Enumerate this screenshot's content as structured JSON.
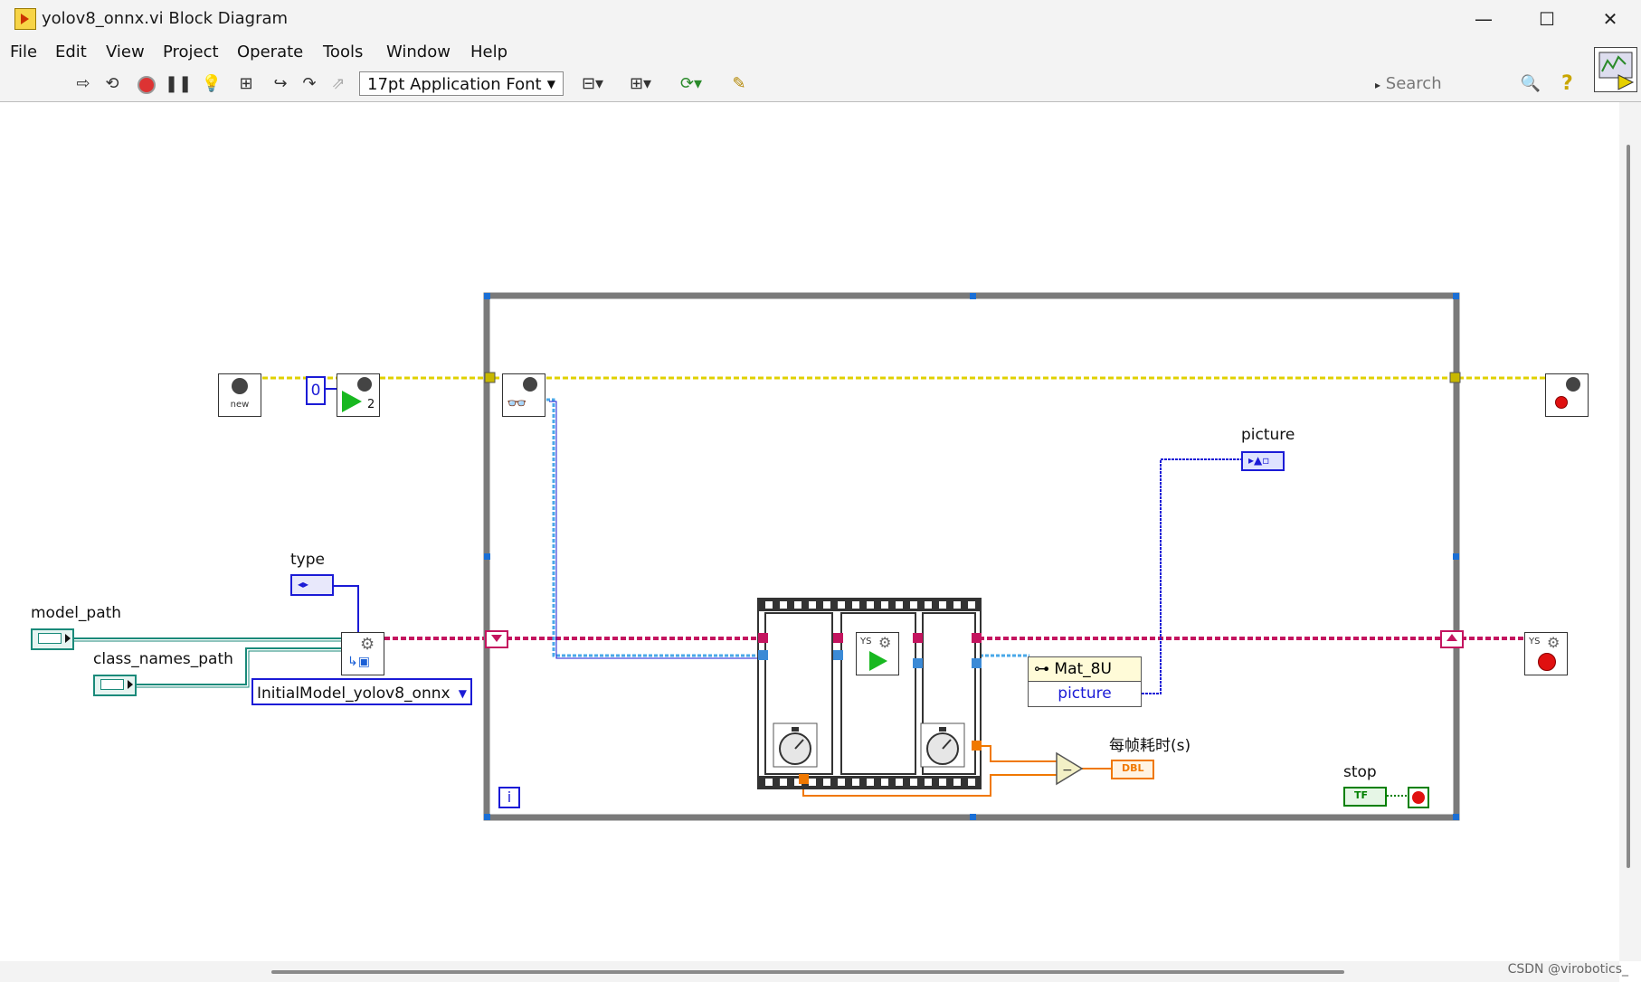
{
  "window": {
    "title": "yolov8_onnx.vi Block Diagram",
    "minimize_glyph": "—",
    "maximize_glyph": "☐",
    "close_glyph": "✕"
  },
  "menu": [
    "File",
    "Edit",
    "View",
    "Project",
    "Operate",
    "Tools",
    "Window",
    "Help"
  ],
  "toolbar": {
    "font_value": "17pt Application Font",
    "search_placeholder": "Search"
  },
  "diagram": {
    "labels": {
      "model_path": "model_path",
      "class_names_path": "class_names_path",
      "type": "type",
      "picture": "picture",
      "frame_time": "每帧耗时(s)",
      "stop": "stop"
    },
    "constants": {
      "zero": "0",
      "enum_value": "InitialModel_yolov8_onnx",
      "iteration_terminal": "i"
    },
    "nodes": {
      "new_label": "new",
      "camera_index": "2",
      "mat_label": "Mat_8U",
      "mat_property": "picture",
      "dbl_label": "DBL",
      "tf_label": "TF",
      "ys_label": "YS"
    }
  },
  "colors": {
    "yellow_wire": "#e0d100",
    "pink_wire": "#c4145f",
    "teal_wire": "#1a8a7a",
    "blue_wire": "#1b1bd6",
    "light_blue_wire": "#4aa8e8",
    "orange_wire": "#f07800",
    "green_wire": "#008000",
    "loop_frame": "#7a7a7a"
  },
  "watermark": "CSDN @virobotics_"
}
